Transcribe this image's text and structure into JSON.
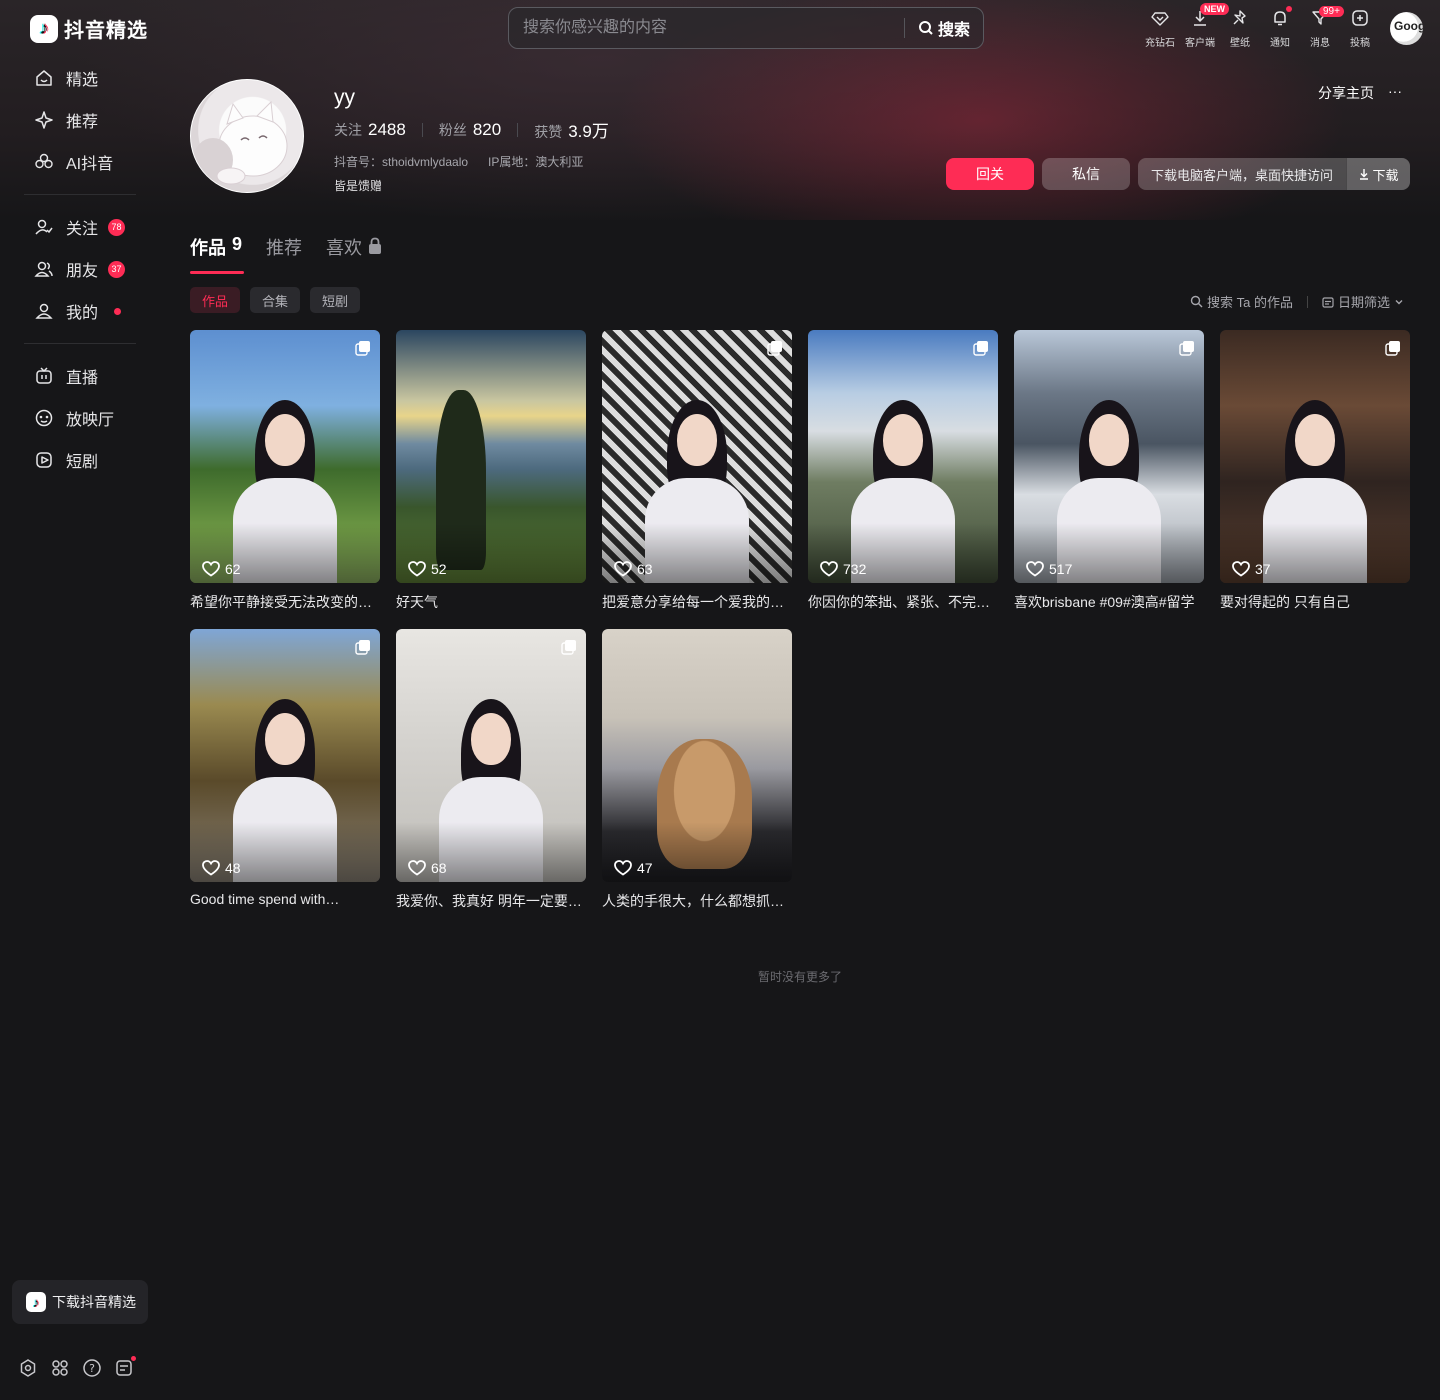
{
  "app": {
    "name": "抖音精选"
  },
  "sidebar": {
    "primary": [
      {
        "label": "精选",
        "icon": "smile-home-icon"
      },
      {
        "label": "推荐",
        "icon": "sparkle-icon"
      },
      {
        "label": "AI抖音",
        "icon": "ai-flower-icon"
      }
    ],
    "social": [
      {
        "label": "关注",
        "icon": "follow-icon",
        "badge": "78"
      },
      {
        "label": "朋友",
        "icon": "friends-icon",
        "badge": "37"
      },
      {
        "label": "我的",
        "icon": "user-icon",
        "dot": true
      }
    ],
    "media": [
      {
        "label": "直播",
        "icon": "tv-icon"
      },
      {
        "label": "放映厅",
        "icon": "film-reel-icon"
      },
      {
        "label": "短剧",
        "icon": "play-clip-icon"
      }
    ],
    "download_label": "下载抖音精选",
    "bottom_icons": [
      "settings-icon",
      "apps-icon",
      "help-icon",
      "feedback-icon"
    ]
  },
  "search": {
    "placeholder": "搜索你感兴趣的内容",
    "button": "搜索"
  },
  "topbar": {
    "actions": [
      {
        "label": "充钻石",
        "icon": "diamond-icon"
      },
      {
        "label": "客户端",
        "icon": "download-icon",
        "badge": "NEW"
      },
      {
        "label": "壁纸",
        "icon": "pin-icon"
      },
      {
        "label": "通知",
        "icon": "bell-icon",
        "dot": true
      },
      {
        "label": "消息",
        "icon": "message-icon",
        "count": "99+"
      },
      {
        "label": "投稿",
        "icon": "upload-plus-icon"
      }
    ],
    "avatar_text": "Goog"
  },
  "profile": {
    "name": "yy",
    "stats": [
      {
        "label": "关注",
        "value": "2488"
      },
      {
        "label": "粉丝",
        "value": "820"
      },
      {
        "label": "获赞",
        "value": "3.9万"
      }
    ],
    "douyin_id": "抖音号：sthoidvmlydaalo",
    "ip_location": "IP属地：澳大利亚",
    "bio": "皆是馈赠",
    "share_label": "分享主页",
    "more": "···",
    "follow_back": "回关",
    "message": "私信",
    "client_tip": "下载电脑客户端，桌面快捷访问",
    "download": "下载"
  },
  "tabs": [
    {
      "label": "作品",
      "count": "9",
      "active": true
    },
    {
      "label": "推荐",
      "count": ""
    },
    {
      "label": "喜欢",
      "count": "",
      "locked": true
    }
  ],
  "chips": [
    {
      "label": "作品",
      "active": true
    },
    {
      "label": "合集"
    },
    {
      "label": "短剧"
    }
  ],
  "tools": {
    "search_works": "搜索 Ta 的作品",
    "date_filter": "日期筛选"
  },
  "videos": [
    {
      "likes": "62",
      "title": "希望你平静接受无法改变的…",
      "multi": true,
      "scene": "park",
      "person": true
    },
    {
      "likes": "52",
      "title": "好天气",
      "multi": false,
      "scene": "sunset",
      "person": false
    },
    {
      "likes": "63",
      "title": "把爱意分享给每一个爱我的…",
      "multi": true,
      "scene": "bathroom",
      "person": true
    },
    {
      "likes": "732",
      "title": "你因你的笨拙、紧张、不完…",
      "multi": true,
      "scene": "sky",
      "person": true
    },
    {
      "likes": "517",
      "title": "喜欢brisbane #09#澳高#留学",
      "multi": true,
      "scene": "city",
      "person": true
    },
    {
      "likes": "37",
      "title": "要对得起的 只有自己",
      "multi": true,
      "scene": "window",
      "person": true
    },
    {
      "likes": "48",
      "title": "Good time spend with…",
      "multi": true,
      "scene": "forest",
      "person": true
    },
    {
      "likes": "68",
      "title": "我爱你、我真好 明年一定要…",
      "multi": true,
      "scene": "room",
      "person": true
    },
    {
      "likes": "47",
      "title": "人类的手很大，什么都想抓…",
      "multi": false,
      "scene": "dog",
      "person": false
    }
  ],
  "end_note": "暂时没有更多了"
}
